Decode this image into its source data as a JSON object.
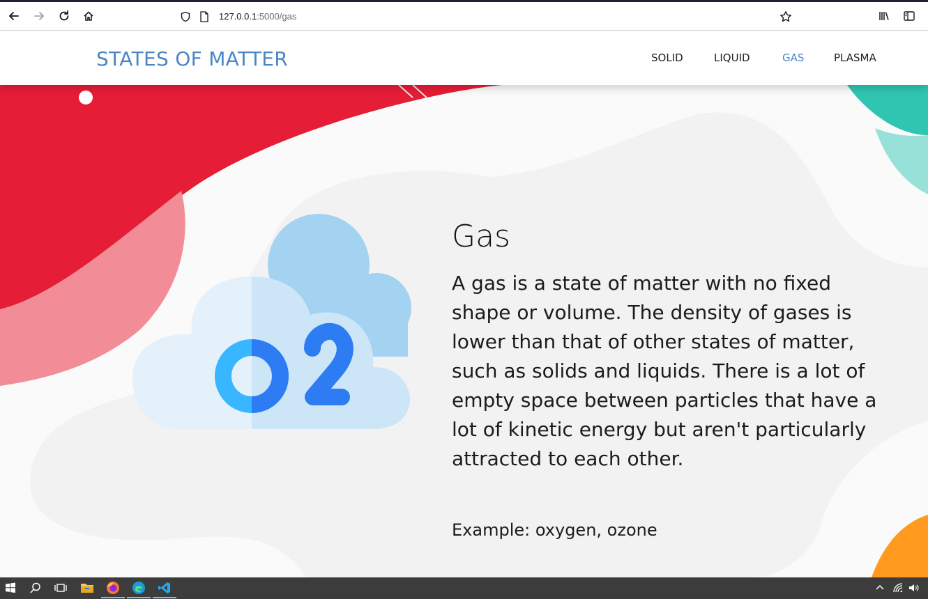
{
  "browser": {
    "url_host": "127.0.0.1",
    "url_path": ":5000/gas"
  },
  "site": {
    "brand": "STATES OF MATTER",
    "nav": [
      {
        "label": "SOLID",
        "active": false
      },
      {
        "label": "LIQUID",
        "active": false
      },
      {
        "label": "GAS",
        "active": true
      },
      {
        "label": "PLASMA",
        "active": false
      }
    ]
  },
  "main": {
    "title": "Gas",
    "description": "A gas is a state of matter with no fixed shape or volume. The density of gases is lower than that of other states of matter, such as solids and liquids. There is a lot of empty space between particles that have a lot of kinetic energy but aren't particularly attracted to each other.",
    "example": "Example: oxygen, ozone"
  },
  "colors": {
    "accent": "#4a86c5",
    "blob_red": "#e51d36",
    "blob_pink": "#f28d97",
    "blob_teal": "#2fc5b1",
    "blob_orange": "#ff9a1f"
  }
}
